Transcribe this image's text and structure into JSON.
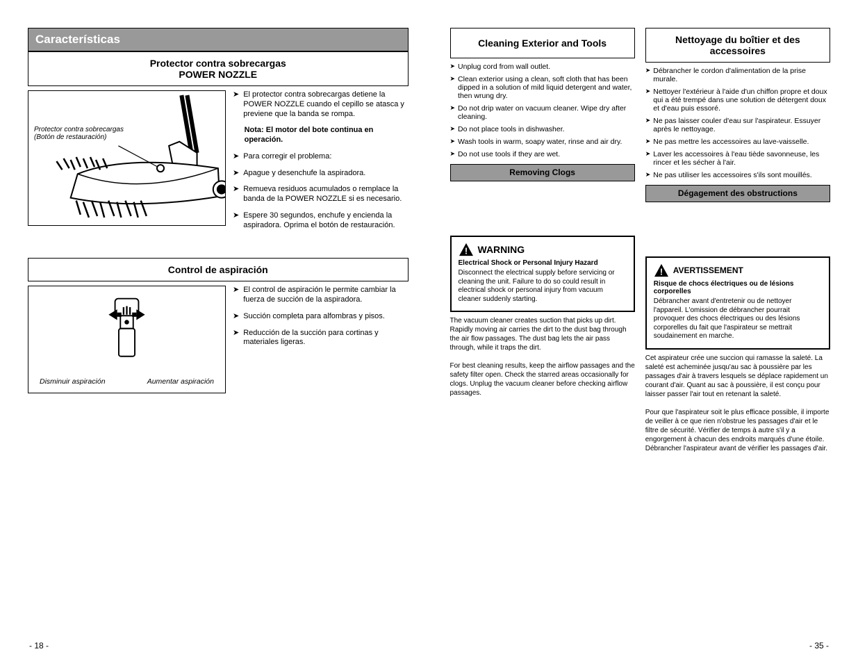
{
  "left": {
    "gray_header": "Características",
    "overload": {
      "title_line1": "Protector contra sobrecargas",
      "title_line2": "POWER NOZZLE",
      "img_caption_line1": "Protector contra sobrecargas",
      "img_caption_line2": "(Botón de restauración)",
      "bullets": [
        "El protector contra sobrecargas detiene la POWER NOZZLE cuando el cepillo se atasca y previene que la banda se rompa.",
        "Nota: El motor del bote continua en operación.",
        "Para corregir el problema:",
        "Apague y desenchufe la aspiradora.",
        "Remueva residuos acumulados o remplace la banda de la POWER NOZZLE si es necesario.",
        "Espere 30 segundos, enchufe y encienda la aspiradora. Oprima el botón de restauración."
      ]
    },
    "suction": {
      "title": "Control de aspiración",
      "decrease": "Disminuir aspiración",
      "increase": "Aumentar aspiración",
      "bullets": [
        "El control de aspiración le permite cambiar la fuerza de succión de la aspiradora.",
        "Succión completa para alfombras y pisos.",
        "Reducción de la succión para cortinas y materiales ligeras."
      ]
    }
  },
  "right": {
    "english": {
      "title": "Cleaning Exterior and Tools",
      "bullets": [
        "Unplug cord from wall outlet.",
        "Clean exterior using a clean, soft cloth that has been dipped in a solution of mild liquid detergent and water, then wrung dry.",
        "Do not drip water on vacuum cleaner. Wipe dry after cleaning.",
        "Do not place tools in dishwasher.",
        "Wash tools in warm, soapy water, rinse and air dry.",
        "Do not use tools if they are wet."
      ],
      "gray1": "Removing Clogs",
      "warn_word": "WARNING",
      "warn_sub": "Electrical Shock or Personal Injury Hazard",
      "warn_text": "Disconnect the electrical supply before servicing or cleaning the unit. Failure to do so could result in electrical shock or personal injury from vacuum cleaner suddenly starting.",
      "note": "The vacuum cleaner creates suction that picks up dirt. Rapidly moving air carries the dirt to the dust bag through the air flow passages. The dust bag lets the air pass through, while it traps the dirt.\n\nFor best cleaning results, keep the airflow passages and the safety filter open. Check the starred areas occasionally for clogs. Unplug the vacuum cleaner before checking airflow passages."
    },
    "french": {
      "title": "Nettoyage du boîtier et des accessoires",
      "bullets": [
        "Débrancher le cordon d'alimentation de la prise murale.",
        "Nettoyer l'extérieur à l'aide d'un chiffon propre et doux qui a été trempé dans une solution de détergent doux et d'eau puis essoré.",
        "Ne pas laisser couler d'eau sur l'aspirateur. Essuyer après le nettoyage.",
        "Ne pas mettre les accessoires au lave-vaisselle.",
        "Laver les accessoires à l'eau tiède savonneuse, les rincer et les sécher à l'air.",
        "Ne pas utiliser les accessoires s'ils sont mouillés."
      ],
      "gray1": "Dégagement des obstructions",
      "warn_word": "AVERTISSEMENT",
      "warn_sub": "Risque de chocs électriques ou de lésions corporelles",
      "warn_text": "Débrancher avant d'entretenir ou de nettoyer l'appareil. L'omission de débrancher pourrait provoquer des chocs électriques ou des lésions corporelles du fait que l'aspirateur se mettrait soudainement en marche.",
      "note": "Cet aspirateur crée une succion qui ramasse la saleté. La saleté est acheminée jusqu'au sac à poussière par les passages d'air à travers lesquels se déplace rapidement un courant d'air. Quant au sac à poussière, il est conçu pour laisser passer l'air tout en retenant la saleté.\n\nPour que l'aspirateur soit le plus efficace possible, il importe de veiller à ce que rien n'obstrue les passages d'air et le filtre de sécurité. Vérifier de temps à autre s'il y a engorgement à chacun des endroits marqués d'une étoile. Débrancher l'aspirateur avant de vérifier les passages d'air."
    }
  },
  "page_left": "- 18 -",
  "page_right": "- 35 -"
}
